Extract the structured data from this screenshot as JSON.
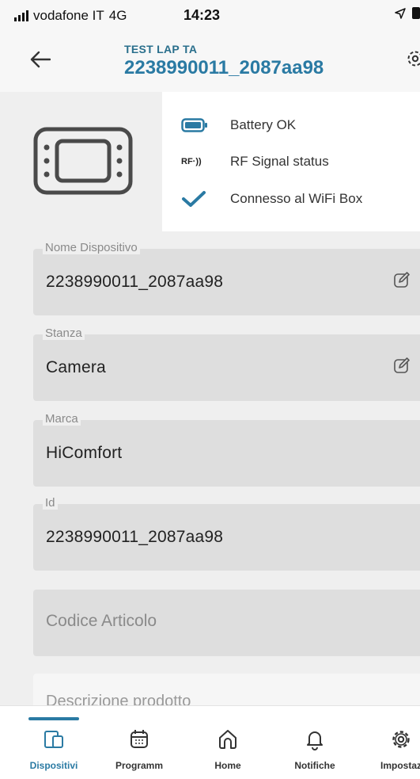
{
  "status_bar": {
    "carrier": "vodafone IT",
    "network": "4G",
    "time": "14:23"
  },
  "header": {
    "subtitle": "TEST LAP TA",
    "title": "2238990011_2087aa98"
  },
  "device_status": {
    "battery": "Battery OK",
    "rf_icon_text": "RF·))",
    "rf_signal": "RF Signal status",
    "wifi": "Connesso al WiFi Box"
  },
  "fields": {
    "nome": {
      "label": "Nome Dispositivo",
      "value": "2238990011_2087aa98"
    },
    "stanza": {
      "label": "Stanza",
      "value": "Camera"
    },
    "marca": {
      "label": "Marca",
      "value": "HiComfort"
    },
    "id": {
      "label": "Id",
      "value": "2238990011_2087aa98"
    },
    "codice": {
      "placeholder": "Codice Articolo"
    },
    "descrizione": {
      "placeholder": "Descrizione prodotto"
    }
  },
  "nav": {
    "items": [
      {
        "label": "Dispositivi",
        "icon": "devices-icon",
        "active": true
      },
      {
        "label": "Programm",
        "icon": "calendar-icon"
      },
      {
        "label": "Home",
        "icon": "home-icon"
      },
      {
        "label": "Notifiche",
        "icon": "bell-icon"
      },
      {
        "label": "Impostaz",
        "icon": "gear-icon"
      }
    ]
  },
  "colors": {
    "accent": "#2a7aa3",
    "field_bg": "#dedede",
    "page_bg": "#efefef"
  }
}
